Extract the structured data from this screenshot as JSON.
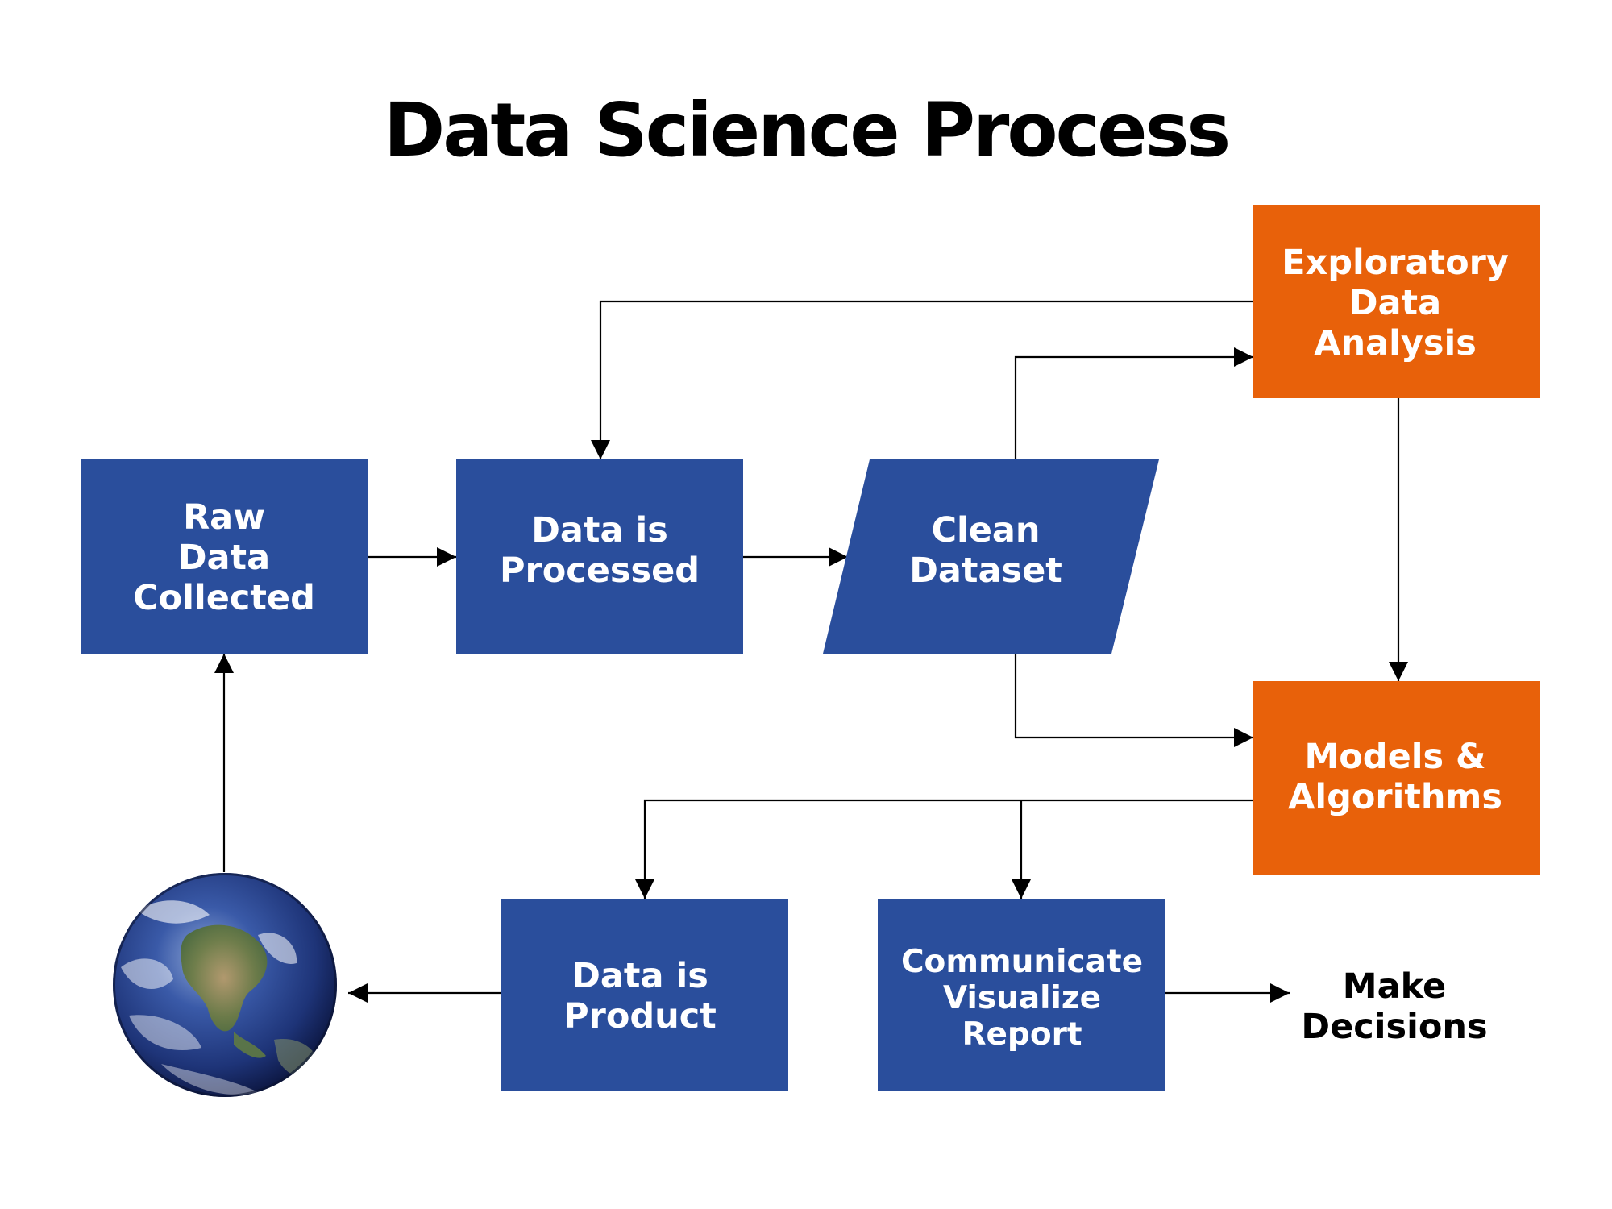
{
  "title": "Data Science Process",
  "colors": {
    "process_blue": "#2A4E9C",
    "analysis_orange": "#E8610A",
    "text_on_node": "#FFFFFF",
    "edge": "#000000"
  },
  "nodes": [
    {
      "id": "raw",
      "shape": "rectangle",
      "color": "process_blue",
      "lines": [
        "Raw",
        "Data",
        "Collected"
      ]
    },
    {
      "id": "processed",
      "shape": "rectangle",
      "color": "process_blue",
      "lines": [
        "Data is",
        "Processed"
      ]
    },
    {
      "id": "clean",
      "shape": "parallelogram",
      "color": "process_blue",
      "lines": [
        "Clean",
        "Dataset"
      ]
    },
    {
      "id": "eda",
      "shape": "rectangle",
      "color": "analysis_orange",
      "lines": [
        "Exploratory",
        "Data",
        "Analysis"
      ]
    },
    {
      "id": "models",
      "shape": "rectangle",
      "color": "analysis_orange",
      "lines": [
        "Models &",
        "Algorithms"
      ]
    },
    {
      "id": "product",
      "shape": "rectangle",
      "color": "process_blue",
      "lines": [
        "Data is",
        "Product"
      ]
    },
    {
      "id": "communicate",
      "shape": "rectangle",
      "color": "process_blue",
      "lines": [
        "Communicate",
        "Visualize",
        "Report"
      ]
    },
    {
      "id": "decisions",
      "shape": "text",
      "lines": [
        "Make",
        "Decisions"
      ]
    },
    {
      "id": "world",
      "shape": "earth-image",
      "icon": "earth-globe-icon",
      "lines": []
    }
  ],
  "edges": [
    {
      "from": "raw",
      "to": "processed"
    },
    {
      "from": "processed",
      "to": "clean"
    },
    {
      "from": "clean",
      "to": "eda"
    },
    {
      "from": "clean",
      "to": "models"
    },
    {
      "from": "eda",
      "to": "processed"
    },
    {
      "from": "eda",
      "to": "models"
    },
    {
      "from": "models",
      "to": "product"
    },
    {
      "from": "models",
      "to": "communicate"
    },
    {
      "from": "communicate",
      "to": "decisions"
    },
    {
      "from": "product",
      "to": "world"
    },
    {
      "from": "world",
      "to": "raw"
    }
  ]
}
